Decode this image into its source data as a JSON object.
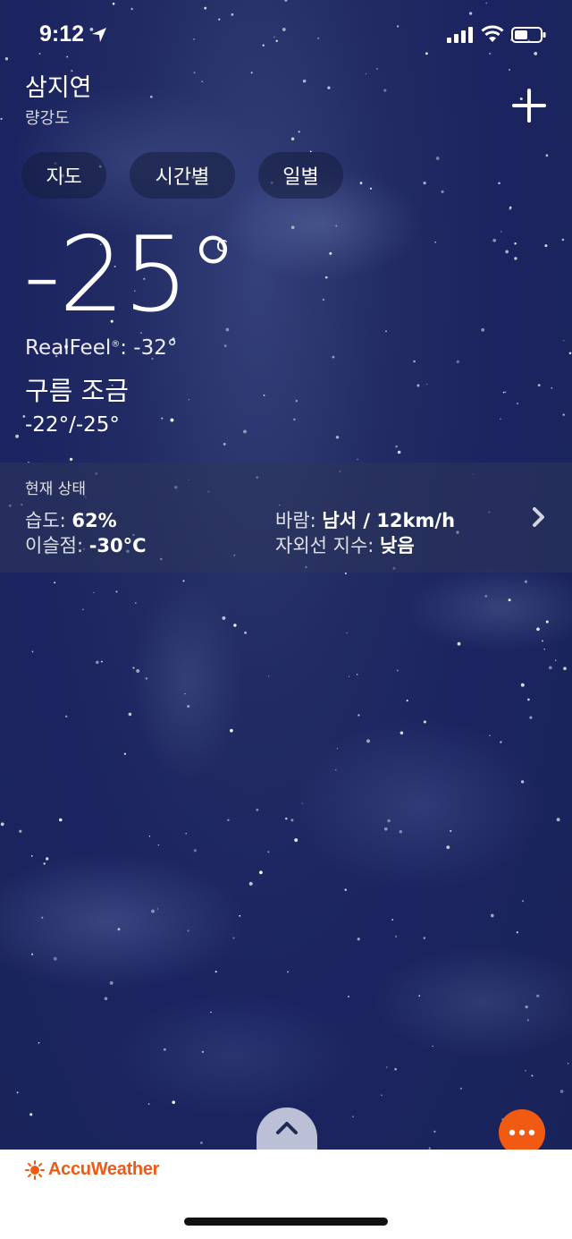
{
  "status_bar": {
    "time": "9:12"
  },
  "location": {
    "city": "삼지연",
    "region": "량강도"
  },
  "tabs": [
    {
      "label": "지도"
    },
    {
      "label": "시간별"
    },
    {
      "label": "일별"
    }
  ],
  "current": {
    "temperature": "-25°",
    "unit": "C",
    "realfeel_label": "RealFeel",
    "realfeel_mark": "®",
    "realfeel_value": ": -32°",
    "condition": "구름 조금",
    "hi_lo": "-22°/-25°"
  },
  "conditions_panel": {
    "title": "현재 상태",
    "humidity": {
      "label": "습도: ",
      "value": "62%"
    },
    "dew_point": {
      "label": "이슬점: ",
      "value": "-30°C"
    },
    "wind": {
      "label": "바람: ",
      "value": "남서 / 12km/h"
    },
    "uv_index": {
      "label": "자외선 지수: ",
      "value": "낮음"
    }
  },
  "footer": {
    "brand": "AccuWeather"
  },
  "colors": {
    "accent": "#f05a12",
    "background": "#1b2460"
  },
  "icons": [
    "location-arrow-icon",
    "signal-icon",
    "wifi-icon",
    "battery-icon",
    "plus-icon",
    "chevron-right-icon",
    "chevron-up-icon",
    "more-dots-icon",
    "sun-logo-icon"
  ]
}
